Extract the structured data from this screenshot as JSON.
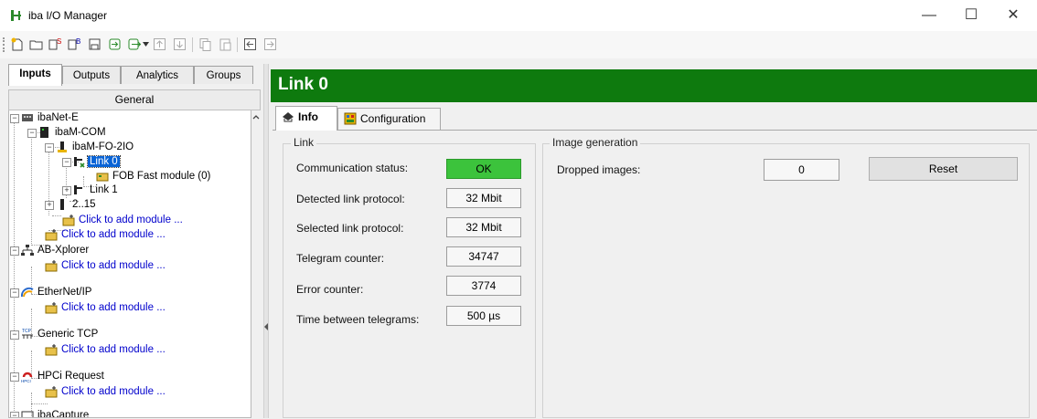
{
  "window": {
    "title": "iba I/O Manager",
    "minimize": "—",
    "maximize": "☐",
    "close": "✕"
  },
  "left_tabs": [
    {
      "label": "Inputs",
      "active": true
    },
    {
      "label": "Outputs"
    },
    {
      "label": "Analytics"
    },
    {
      "label": "Groups"
    }
  ],
  "general_label": "General",
  "tree": {
    "ibanet_e": "ibaNet-E",
    "ibam_com": "ibaM-COM",
    "ibam_fo": "ibaM-FO-2IO",
    "link0": "Link 0",
    "fob": "FOB Fast module (0)",
    "link1": "Link 1",
    "range": "2..15",
    "add_module_1": "Click to add module ...",
    "add_module_2": "Click to add module ...",
    "ab_xplorer": "AB-Xplorer",
    "add_module_3": "Click to add module ...",
    "ethernet_ip": "EtherNet/IP",
    "add_module_4": "Click to add module ...",
    "generic_tcp": "Generic TCP",
    "add_module_5": "Click to add module ...",
    "hpci_request": "HPCi Request",
    "add_module_6": "Click to add module ...",
    "last_item": "ibaCapture"
  },
  "header": {
    "title": "Link 0"
  },
  "right_tabs": [
    {
      "label": "Info",
      "active": true
    },
    {
      "label": "Configuration"
    }
  ],
  "link_group": {
    "title": "Link",
    "communication_status_label": "Communication status:",
    "communication_status": "OK",
    "detected_protocol_label": "Detected link protocol:",
    "detected_protocol": "32 Mbit",
    "selected_protocol_label": "Selected link protocol:",
    "selected_protocol": "32 Mbit",
    "telegram_counter_label": "Telegram counter:",
    "telegram_counter": "34747",
    "error_counter_label": "Error counter:",
    "error_counter": "3774",
    "time_between_label": "Time between telegrams:",
    "time_between": "500 µs"
  },
  "image_group": {
    "title": "Image generation",
    "dropped_images_label": "Dropped images:",
    "dropped_images": "0",
    "reset_label": "Reset"
  },
  "colors": {
    "header_green": "#0e7a0e",
    "status_ok": "#3cc33c",
    "selection": "#0a64d6"
  }
}
